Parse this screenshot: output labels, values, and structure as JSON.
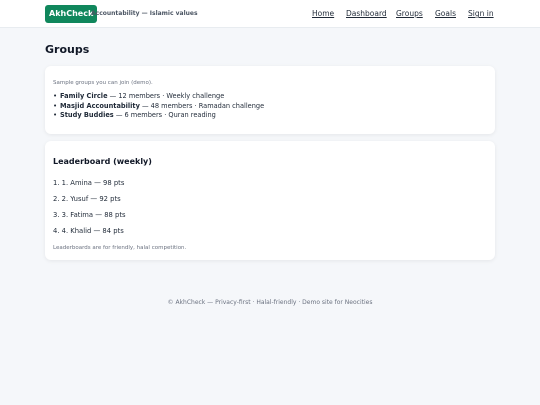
{
  "header": {
    "brand": "AkhCheck",
    "tagline": "Accountability — Islamic values",
    "nav": [
      {
        "label": "Home"
      },
      {
        "label": "Dashboard"
      },
      {
        "label": "Groups"
      },
      {
        "label": "Goals"
      },
      {
        "label": "Sign in"
      }
    ]
  },
  "page": {
    "title": "Groups"
  },
  "groups_card": {
    "intro": "Sample groups you can join (demo).",
    "groups": [
      {
        "name": "Family Circle",
        "detail": " — 12 members · Weekly challenge"
      },
      {
        "name": "Masjid Accountability",
        "detail": " — 48 members · Ramadan challenge"
      },
      {
        "name": "Study Buddies",
        "detail": " — 6 members · Quran reading"
      }
    ]
  },
  "leaderboard": {
    "title": "Leaderboard (weekly)",
    "rows": [
      "1. 1. Amina — 98 pts",
      "2. 2. Yusuf — 92 pts",
      "3. 3. Fatima — 88 pts",
      "4. 4. Khalid — 84 pts"
    ],
    "note": "Leaderboards are for friendly, halal competition."
  },
  "footer": {
    "text": "© AkhCheck — Privacy-first · Halal-friendly · Demo site for Neocities"
  },
  "colors": {
    "brand": "#10875c",
    "background": "#f5f7fa"
  }
}
